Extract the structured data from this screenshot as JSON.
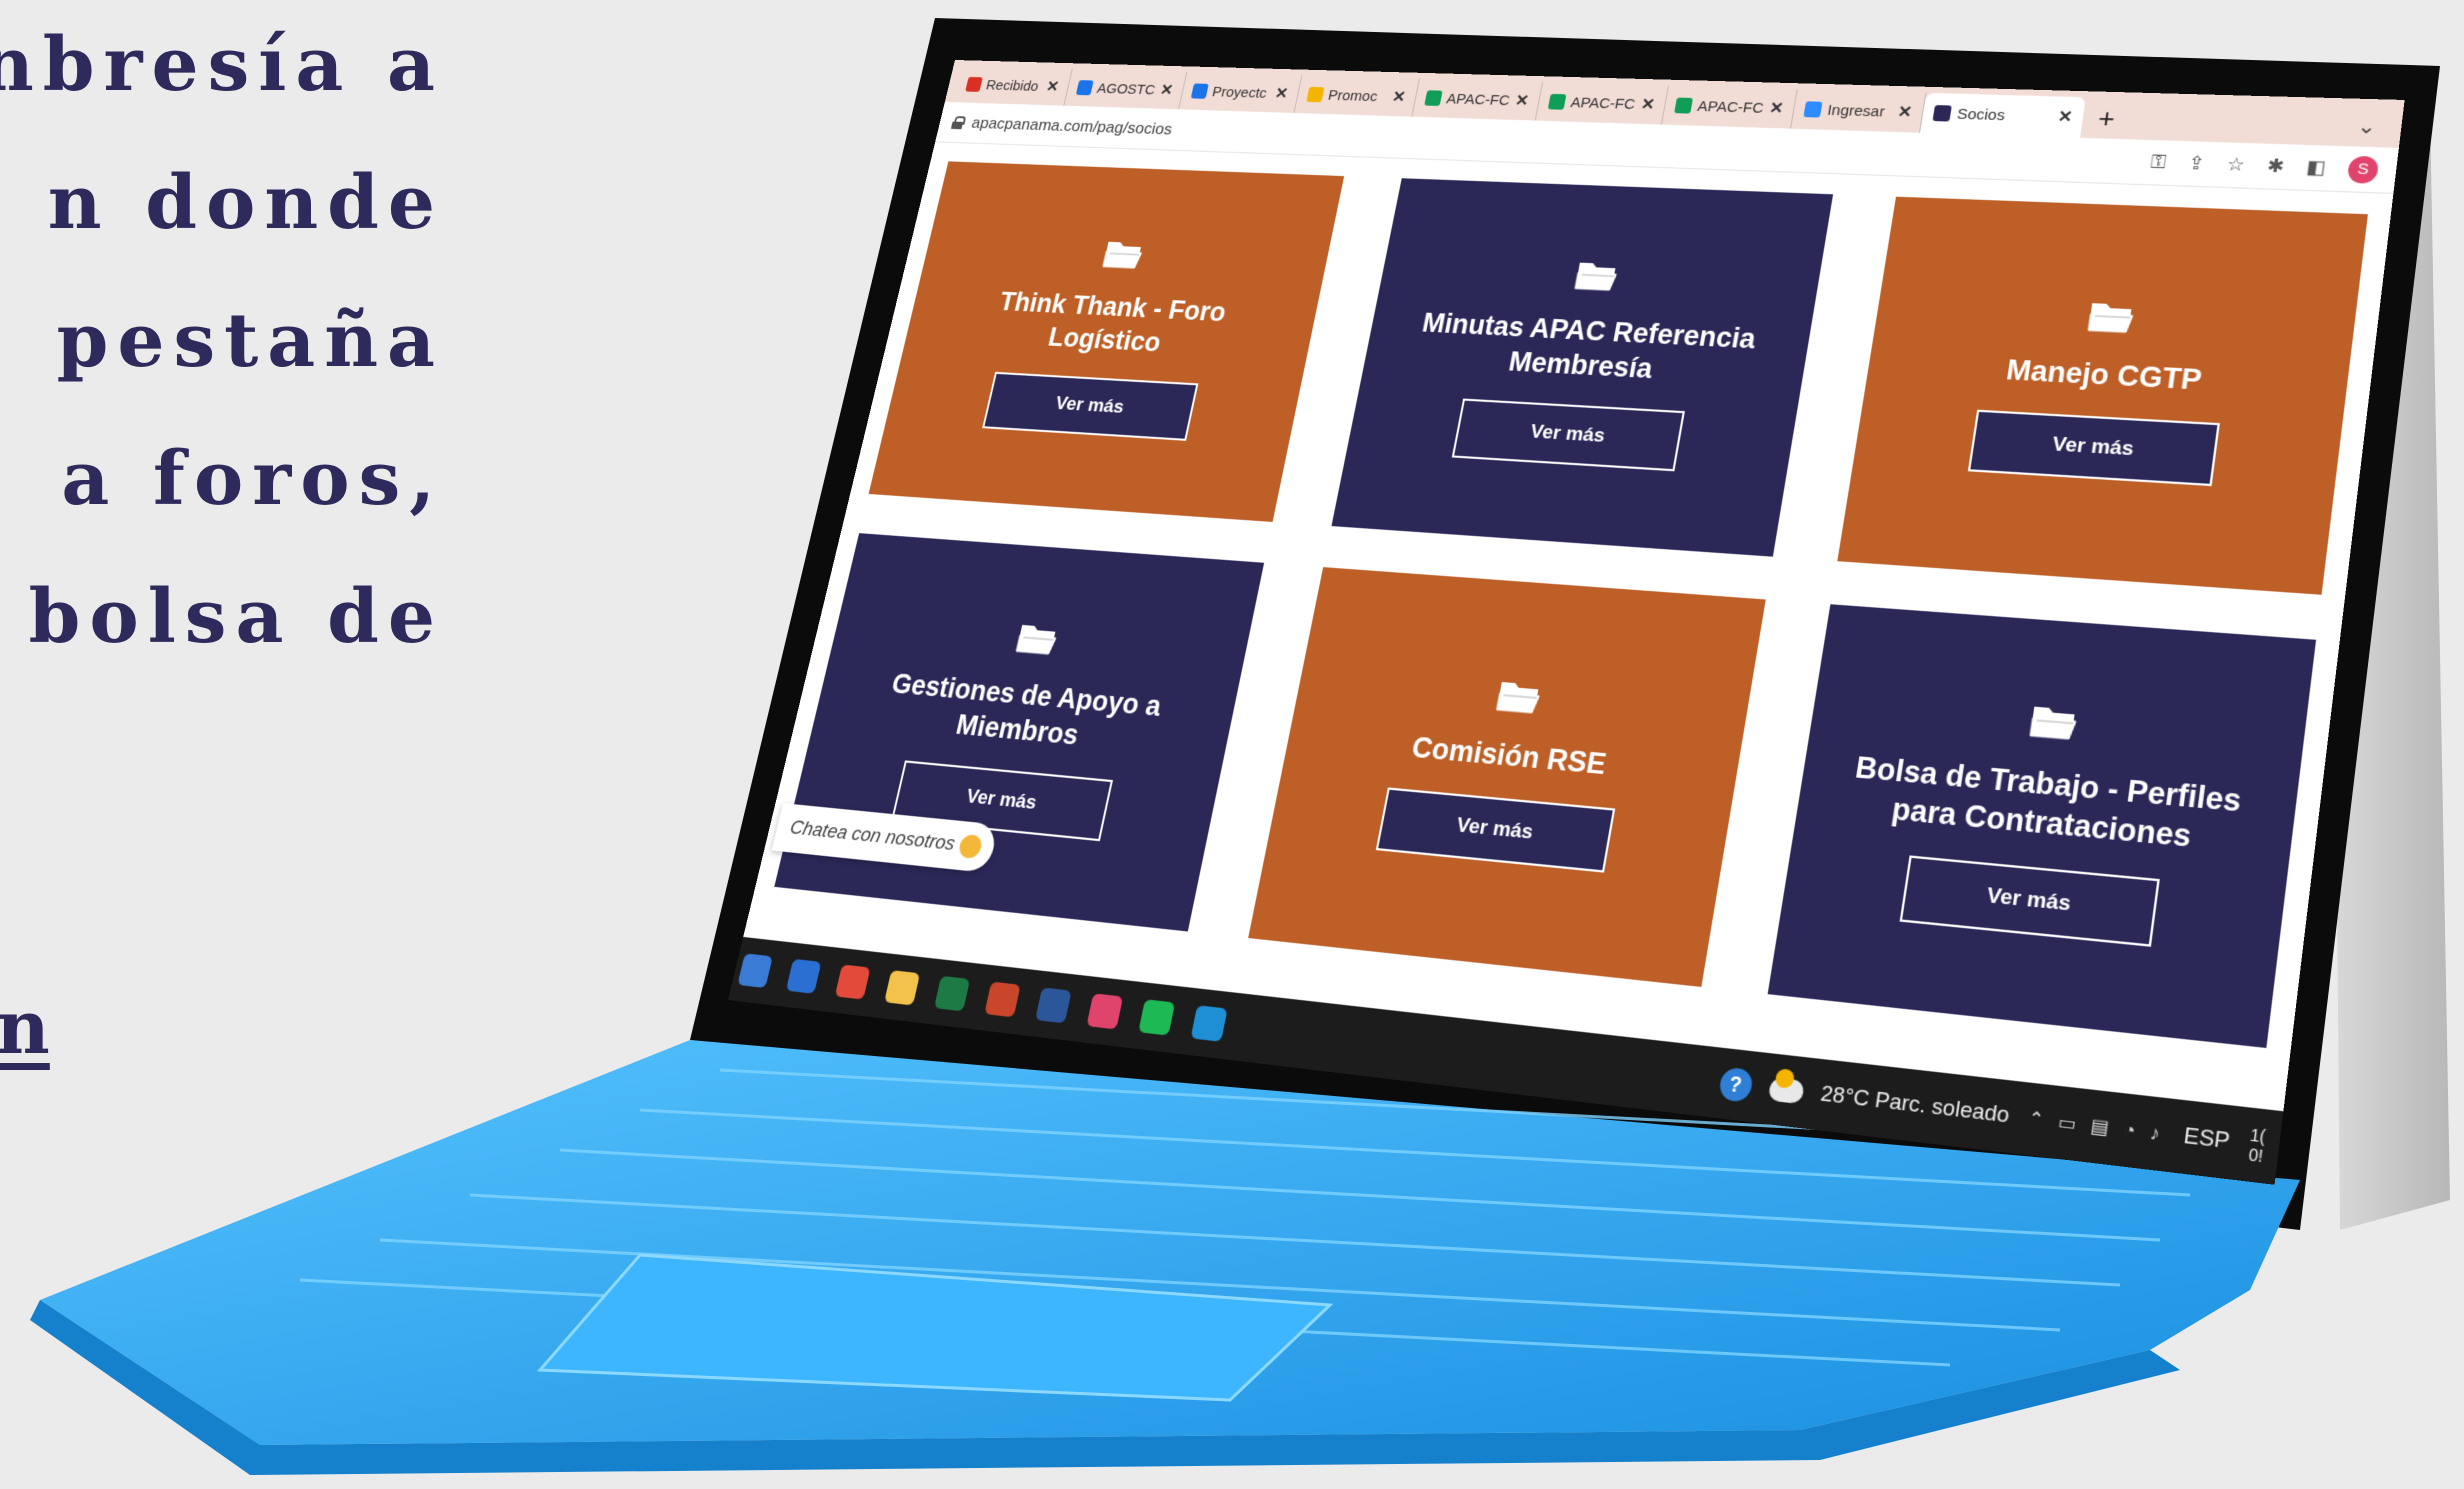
{
  "left_text": {
    "lines": [
      "nbresía a",
      "n donde",
      "pestaña",
      "a foros,",
      "bolsa de"
    ],
    "link_fragment": "n"
  },
  "browser": {
    "tabs": [
      {
        "label": "Recibido",
        "icon": "gmail-icon",
        "color": "#d93025"
      },
      {
        "label": "AGOSTC",
        "icon": "canva-icon",
        "color": "#1a73e8"
      },
      {
        "label": "Proyectc",
        "icon": "canva-icon",
        "color": "#1a73e8"
      },
      {
        "label": "Promoc",
        "icon": "drive-icon",
        "color": "#f4b400"
      },
      {
        "label": "APAC-FC",
        "icon": "sheets-icon",
        "color": "#0f9d58"
      },
      {
        "label": "APAC-FC",
        "icon": "sheets-icon",
        "color": "#0f9d58"
      },
      {
        "label": "APAC-FC",
        "icon": "sheets-icon",
        "color": "#0f9d58"
      },
      {
        "label": "Ingresar",
        "icon": "zoom-icon",
        "color": "#2d8cff"
      },
      {
        "label": "Socios",
        "icon": "apac-icon",
        "color": "#2b2858",
        "active": true
      }
    ],
    "close_glyph": "✕",
    "new_tab_glyph": "+",
    "menu_glyph": "⌄",
    "url": "apacpanama.com/pag/socios",
    "profile_initial": "S"
  },
  "cards": [
    {
      "title": "Think Thank - Foro Logístico",
      "button": "Ver más",
      "color": "orange"
    },
    {
      "title": "Minutas APAC Referencia Membresía",
      "button": "Ver más",
      "color": "navy"
    },
    {
      "title": "Manejo CGTP",
      "button": "Ver más",
      "color": "orange"
    },
    {
      "title": "Gestiones de Apoyo a Miembros",
      "button": "Ver más",
      "color": "navy"
    },
    {
      "title": "Comisión RSE",
      "button": "Ver más",
      "color": "orange"
    },
    {
      "title": "Bolsa de Trabajo - Perfiles para Contrataciones",
      "button": "Ver más",
      "color": "navy"
    }
  ],
  "chat": {
    "label": "Chatea con nosotros"
  },
  "taskbar": {
    "apps": [
      {
        "name": "store-icon",
        "color": "#3a7bd5"
      },
      {
        "name": "mail-icon",
        "color": "#2a6fd1"
      },
      {
        "name": "chrome-icon",
        "color": "#e34a3a"
      },
      {
        "name": "explorer-icon",
        "color": "#f2c24a"
      },
      {
        "name": "excel-icon",
        "color": "#1e7a45"
      },
      {
        "name": "powerpoint-icon",
        "color": "#c9462c"
      },
      {
        "name": "word-icon",
        "color": "#2b579a"
      },
      {
        "name": "chrome-profile-icon",
        "color": "#e0446c"
      },
      {
        "name": "spotify-icon",
        "color": "#1db954"
      },
      {
        "name": "edge-icon",
        "color": "#1f8fd6"
      }
    ],
    "weather": "28°C  Parc. soleado",
    "language": "ESP",
    "clock_line1": "1(",
    "clock_line2": "0!"
  },
  "colors": {
    "orange": "#bd5f27",
    "navy": "#2b2858",
    "keyboard": "#2fa8f0",
    "text": "#2e2a5c"
  }
}
